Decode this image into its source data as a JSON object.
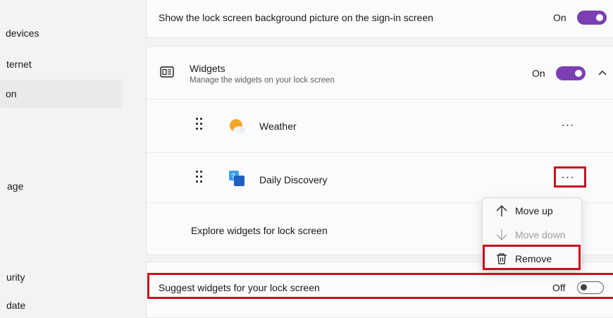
{
  "sidebar": {
    "items": [
      {
        "label": "devices"
      },
      {
        "label": "ternet"
      },
      {
        "label": "on"
      },
      {
        "label": "age"
      },
      {
        "label": "urity"
      },
      {
        "label": "date"
      }
    ]
  },
  "lock_bg": {
    "label": "Show the lock screen background picture on the sign-in screen",
    "state": "On"
  },
  "widgets": {
    "title": "Widgets",
    "subtitle": "Manage the widgets on your lock screen",
    "state": "On",
    "items": [
      {
        "label": "Weather",
        "icon": "weather-sun-cloud-icon",
        "more": "···"
      },
      {
        "label": "Daily Discovery",
        "icon": "daily-discovery-icon",
        "more": "···"
      }
    ],
    "explore_label": "Explore widgets for lock screen"
  },
  "context_menu": {
    "items": [
      {
        "label": "Move up",
        "icon": "arrow-up-icon",
        "enabled": true
      },
      {
        "label": "Move down",
        "icon": "arrow-down-icon",
        "enabled": false
      },
      {
        "label": "Remove",
        "icon": "trash-icon",
        "enabled": true
      }
    ]
  },
  "suggest": {
    "label": "Suggest widgets for your lock screen",
    "state": "Off"
  },
  "colors": {
    "accent": "#7b3fb3",
    "highlight": "#c8101e"
  }
}
